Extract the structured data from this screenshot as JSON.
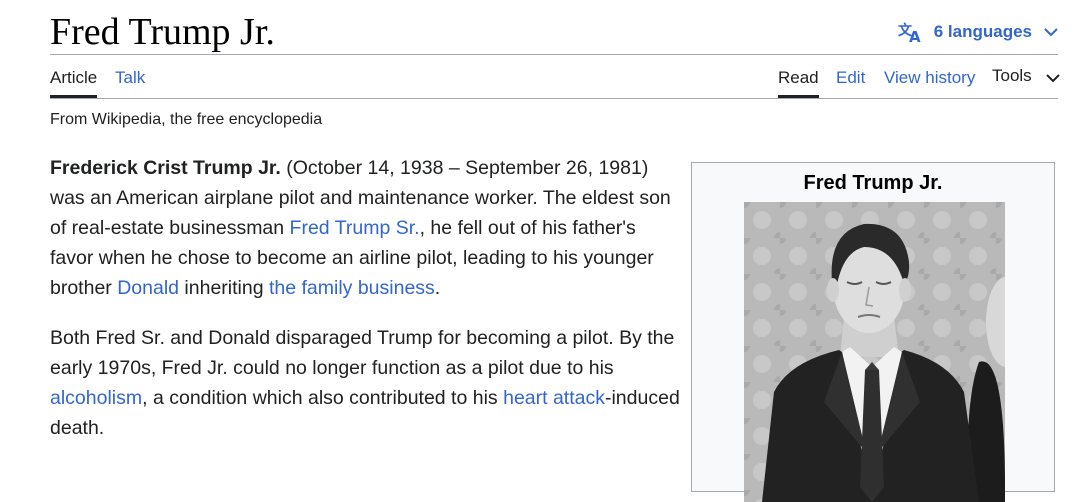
{
  "page": {
    "title": "Fred Trump Jr.",
    "languages_label": "6 languages",
    "icons": {
      "language": "translate-icon",
      "dropdown": "chevron-down-icon"
    }
  },
  "tabs": {
    "article": "Article",
    "talk": "Talk",
    "read": "Read",
    "edit": "Edit",
    "view_history": "View history",
    "tools": "Tools"
  },
  "tagline": "From Wikipedia, the free encyclopedia",
  "lead": {
    "p1": {
      "bold_name": "Frederick Crist Trump Jr.",
      "t1": " (October 14, 1938 – September 26, 1981) was an American airplane pilot and maintenance worker. The eldest son of real-estate businessman ",
      "link1": "Fred Trump Sr.",
      "t2": ", he fell out of his father's favor when he chose to become an airline pilot, leading to his younger brother ",
      "link2": "Donald",
      "t3": " inheriting ",
      "link3": "the family business",
      "t4": "."
    },
    "p2": {
      "t1": "Both Fred Sr. and Donald disparaged Trump for becoming a pilot. By the early 1970s, Fred Jr. could no longer function as a pilot due to his ",
      "link1": "alcoholism",
      "t2": ", a condition which also contributed to his ",
      "link2": "heart attack",
      "t3": "-induced death."
    }
  },
  "infobox": {
    "title": "Fred Trump Jr."
  },
  "colors": {
    "link": "#3366cc",
    "text": "#202122",
    "border": "#a2a9b1",
    "infobox_bg": "#f8f9fa"
  }
}
